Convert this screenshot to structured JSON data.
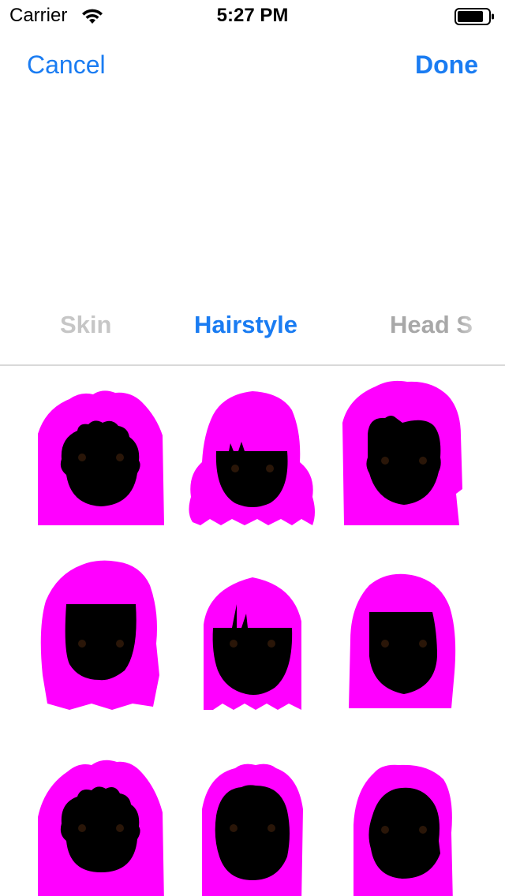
{
  "status_bar": {
    "carrier": "Carrier",
    "time": "5:27 PM",
    "icons": [
      "wifi-icon",
      "battery-icon"
    ]
  },
  "nav": {
    "cancel_label": "Cancel",
    "done_label": "Done",
    "accent_color": "#1a7cf2"
  },
  "tabs": [
    {
      "label": "Skin",
      "selected": false
    },
    {
      "label": "Hairstyle",
      "selected": true
    },
    {
      "label": "Head S",
      "selected": false
    }
  ],
  "hairstyles": {
    "hair_color": "#ff00ff",
    "face_color": "#000000",
    "count": 9
  }
}
